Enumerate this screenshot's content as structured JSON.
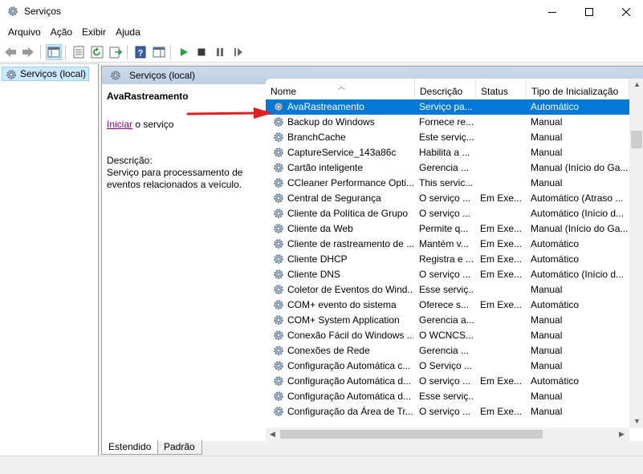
{
  "window": {
    "title": "Serviços"
  },
  "menu": [
    "Arquivo",
    "Ação",
    "Exibir",
    "Ajuda"
  ],
  "tree": {
    "root_label": "Serviços (local)"
  },
  "panel": {
    "header_title": "Serviços (local)",
    "selected_service": "AvaRastreamento",
    "start_link": "Iniciar",
    "start_suffix": "o serviço",
    "description_label": "Descrição:",
    "description_text": "Serviço para processamento de eventos relacionados a veículo."
  },
  "columns": {
    "name": "Nome",
    "description": "Descrição",
    "status": "Status",
    "startup": "Tipo de Inicialização"
  },
  "services": [
    {
      "name": "AvaRastreamento",
      "description": "Serviço pa...",
      "status": "",
      "startup": "Automático",
      "selected": true
    },
    {
      "name": "Backup do Windows",
      "description": "Fornece re...",
      "status": "",
      "startup": "Manual"
    },
    {
      "name": "BranchCache",
      "description": "Este serviç...",
      "status": "",
      "startup": "Manual"
    },
    {
      "name": "CaptureService_143a86c",
      "description": "Habilita a ...",
      "status": "",
      "startup": "Manual"
    },
    {
      "name": "Cartão inteligente",
      "description": "Gerencia ...",
      "status": "",
      "startup": "Manual (Início do Ga..."
    },
    {
      "name": "CCleaner Performance Opti...",
      "description": "This servic...",
      "status": "",
      "startup": "Manual"
    },
    {
      "name": "Central de Segurança",
      "description": "O serviço ...",
      "status": "Em Exe...",
      "startup": "Automático (Atraso ..."
    },
    {
      "name": "Cliente da Política de Grupo",
      "description": "O serviço ...",
      "status": "",
      "startup": "Automático (Início d..."
    },
    {
      "name": "Cliente da Web",
      "description": "Permite q...",
      "status": "Em Exe...",
      "startup": "Manual (Início do Ga..."
    },
    {
      "name": "Cliente de rastreamento de ...",
      "description": "Mantém v...",
      "status": "Em Exe...",
      "startup": "Automático"
    },
    {
      "name": "Cliente DHCP",
      "description": "Registra e ...",
      "status": "Em Exe...",
      "startup": "Automático"
    },
    {
      "name": "Cliente DNS",
      "description": "O serviço ...",
      "status": "Em Exe...",
      "startup": "Automático (Início d..."
    },
    {
      "name": "Coletor de Eventos do Wind...",
      "description": "Esse serviç...",
      "status": "",
      "startup": "Manual"
    },
    {
      "name": "COM+ evento do sistema",
      "description": "Oferece s...",
      "status": "Em Exe...",
      "startup": "Automático"
    },
    {
      "name": "COM+ System Application",
      "description": "Gerencia a...",
      "status": "",
      "startup": "Manual"
    },
    {
      "name": "Conexão Fácil do Windows ...",
      "description": "O WCNCS...",
      "status": "",
      "startup": "Manual"
    },
    {
      "name": "Conexões de Rede",
      "description": "Gerencia ...",
      "status": "",
      "startup": "Manual"
    },
    {
      "name": "Configuração Automática c...",
      "description": "O Serviço ...",
      "status": "",
      "startup": "Manual"
    },
    {
      "name": "Configuração Automática d...",
      "description": "O serviço ...",
      "status": "Em Exe...",
      "startup": "Automático"
    },
    {
      "name": "Configuração Automática d...",
      "description": "Esse serviç...",
      "status": "",
      "startup": "Manual"
    },
    {
      "name": "Configuração da Área de Tr...",
      "description": "O serviço ...",
      "status": "Em Exe...",
      "startup": "Manual"
    }
  ],
  "tabs": [
    "Estendido",
    "Padrão"
  ],
  "colors": {
    "selection": "#0078d7",
    "annotation_arrow": "#e02020",
    "header_band": "#c5d5e8"
  }
}
